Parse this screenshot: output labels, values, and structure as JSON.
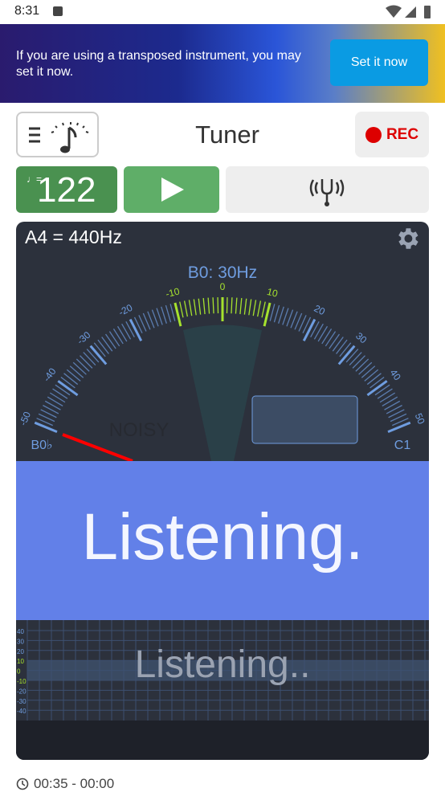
{
  "status_bar": {
    "time": "8:31"
  },
  "banner": {
    "text": "If you are using a transposed instrument, you may set it now.",
    "button": "Set it now",
    "colors": {
      "button": "#0a9be3"
    }
  },
  "header": {
    "title": "Tuner",
    "rec_label": "REC",
    "menu_icon": "menu-metronome-icon"
  },
  "toolbar": {
    "tempo": "122",
    "play_icon": "play-icon",
    "fork_icon": "tuning-fork-icon"
  },
  "tuner": {
    "reference": "A4 = 440Hz",
    "note": "B0: 30Hz",
    "left_note": "B0♭",
    "right_note": "C1",
    "noisy_label": "NOISY",
    "status": "Listening.",
    "scale_labels": [
      "-50",
      "-40",
      "-30",
      "-20",
      "-10",
      "0",
      "10",
      "20",
      "30",
      "40",
      "50"
    ],
    "in_tune_range_cents": 10,
    "colors": {
      "in_tune": "#a6e22e",
      "scale": "#6f9de0",
      "needle": "#ff0000",
      "band": "#6280e8"
    }
  },
  "history": {
    "axis_labels": [
      "40",
      "30",
      "20",
      "10",
      "0",
      "-10",
      "-20",
      "-30",
      "-40"
    ],
    "status": "Listening.."
  },
  "footer": {
    "time_range": "00:35 - 00:00"
  }
}
